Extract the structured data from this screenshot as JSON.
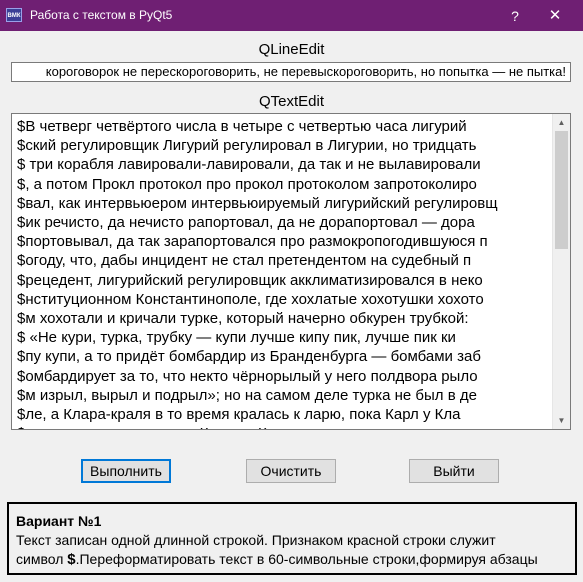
{
  "window": {
    "title": "Работа с текстом в PyQt5",
    "icon_label": "ВМК",
    "help_glyph": "?",
    "close_glyph": "✕"
  },
  "line_edit": {
    "label": "QLineEdit",
    "value": "короговорок не перескороговорить, не перевыскороговорить, но попытка — не пытка!"
  },
  "text_edit": {
    "label": "QTextEdit",
    "lines": [
      "$В четверг четвёртого числа в четыре с четвертью часа лигурий",
      "$ский регулировщик Лигурий регулировал в Лигурии, но тридцать",
      "$ три корабля лавировали-лавировали, да так и не вылавировали",
      "$, а потом Прокл протокол про прокол протоколом запротоколиро",
      "$вал, как интервьюером интервьюируемый лигурийский регулировщ",
      "$ик речисто, да нечисто рапортовал, да не дорапортовал — дора",
      "$портовывал, да так зарапортовался про размокропогодившуюся п",
      "$огоду, что, дабы инцидент не стал претендентом на судебный п",
      "$рецедент, лигурийский регулировщик акклиматизировался в неко",
      "$нституционном Константинополе, где хохлатые хохотушки хохото",
      "$м хохотали и кричали турке, который начерно обкурен трубкой:",
      "$ «Не кури, турка, трубку — купи лучше кипу пик, лучше пик ки",
      "$пу купи, а то придёт бомбардир из Бранденбурга — бомбами заб",
      "$омбардирует за то, что некто чёрнорылый у него полдвора рыло",
      "$м изрыл, вырыл и подрыл»; но на самом деле турка не был в де",
      "$ле, а Клара-краля в то время кралась к ларю, пока Карл у Кла",
      "$ры кораллы крал, за что Клара у Карла украла кларнет, а пото"
    ]
  },
  "buttons": {
    "execute": "Выполнить",
    "clear": "Очистить",
    "exit": "Выйти"
  },
  "variant": {
    "title": "Вариант №1",
    "line1": "Текст записан одной длинной строкой. Признаком красной строки служит",
    "line2_prefix": "символ ",
    "line2_symbol": "$",
    "line2_suffix": ".Переформатировать текст в 60-символьные строки,формируя абзацы"
  },
  "colors": {
    "titlebar": "#6f1f73",
    "focus_border": "#0078d7"
  }
}
